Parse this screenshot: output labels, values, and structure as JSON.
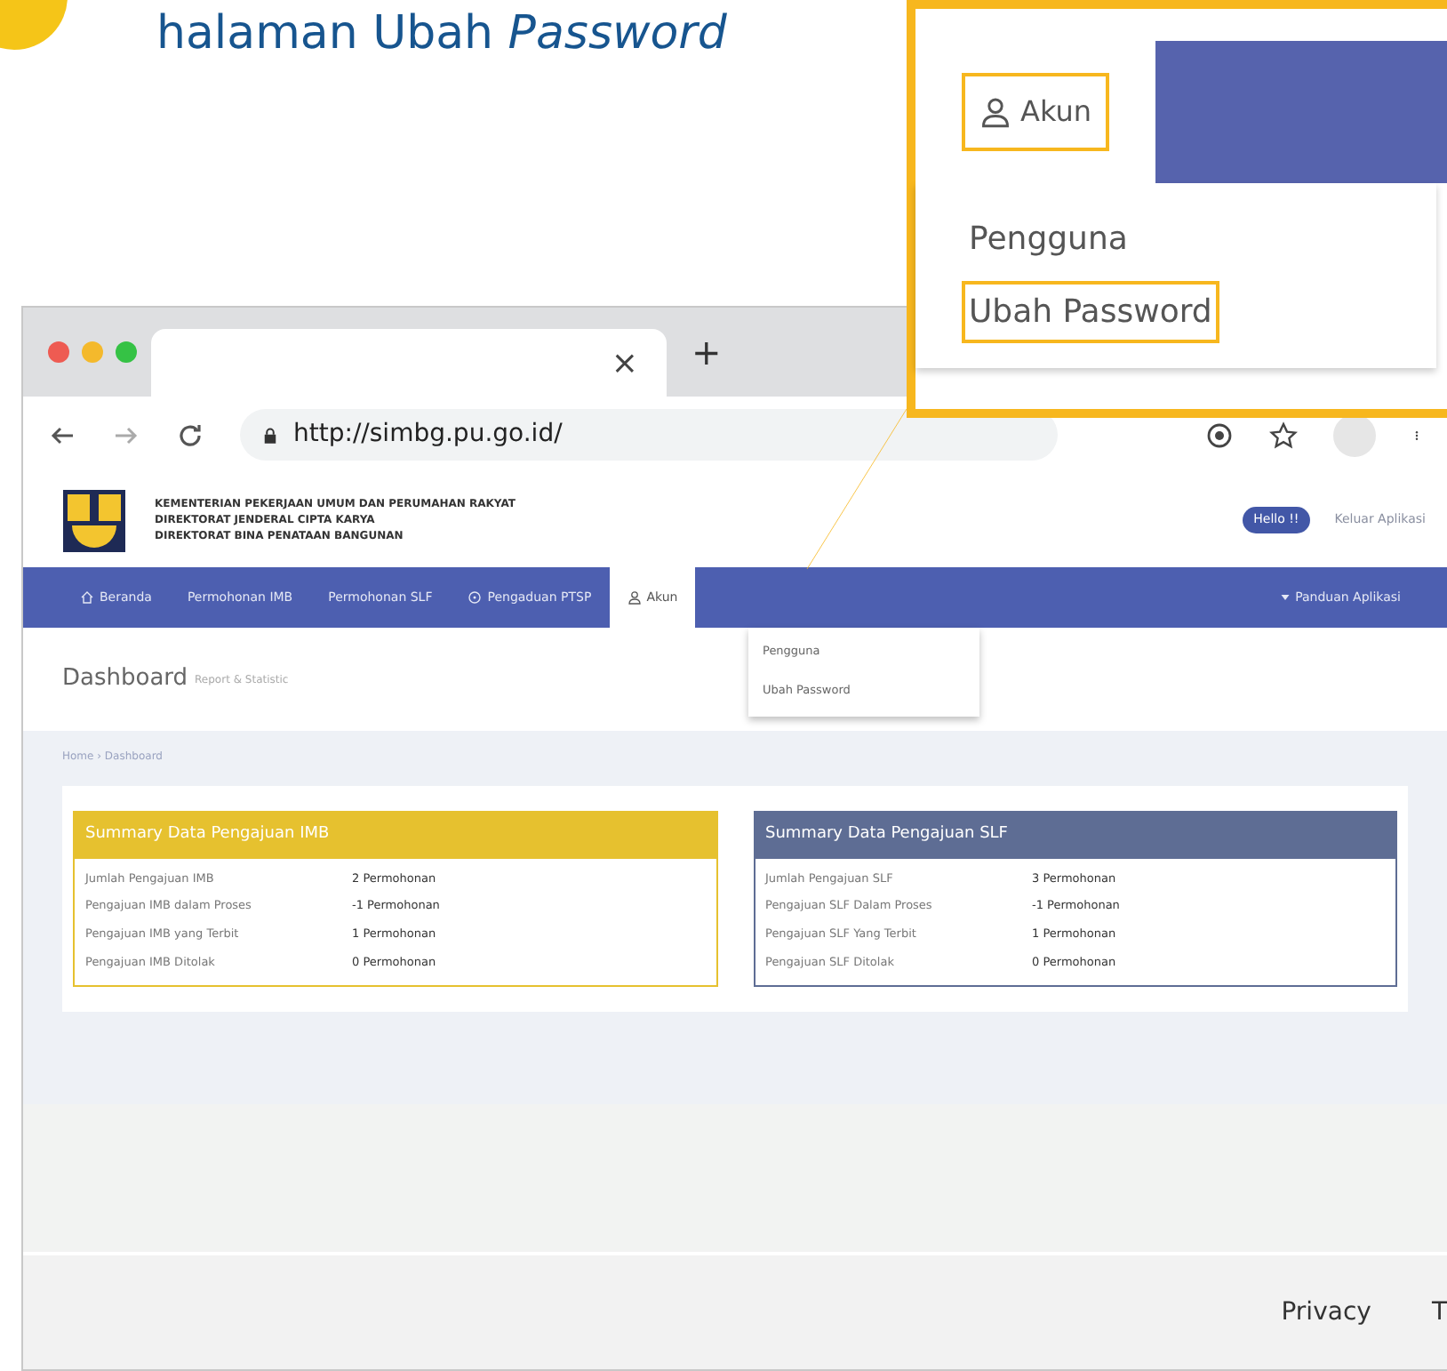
{
  "heading": {
    "text": "halaman Ubah *Password*"
  },
  "browser": {
    "tab_close": "×",
    "new_tab": "+",
    "url": "http://simbg.pu.go.id/"
  },
  "site": {
    "org_lines": [
      "KEMENTERIAN PEKERJAAN UMUM DAN PERUMAHAN RAKYAT",
      "DIREKTORAT JENDERAL CIPTA KARYA",
      "DIREKTORAT BINA PENATAAN BANGUNAN"
    ],
    "user_badge": "Hello !!",
    "header_link": "Keluar Aplikasi",
    "nav": [
      {
        "kind": "home",
        "label": "Beranda",
        "selected": false
      },
      {
        "kind": "plain",
        "label": "Permohonan IMB",
        "selected": false
      },
      {
        "kind": "plain",
        "label": "Permohonan SLF",
        "selected": false
      },
      {
        "kind": "help",
        "label": "Pengaduan PTSP",
        "selected": false
      },
      {
        "kind": "account",
        "label": "Akun",
        "selected": true
      }
    ],
    "nav_right": {
      "label": "Panduan Aplikasi"
    },
    "dropdown": [
      "Pengguna",
      "Ubah Password"
    ],
    "page_title": "Dashboard",
    "page_subtitle": "Report & Statistic",
    "breadcrumb": "Home › Dashboard",
    "cards": [
      {
        "title": "Summary Data Pengajuan IMB",
        "color": "#e6c12f",
        "rows": [
          [
            "Jumlah Pengajuan IMB",
            "2 Permohonan"
          ],
          [
            "Pengajuan IMB dalam Proses",
            "-1 Permohonan"
          ],
          [
            "Pengajuan IMB yang Terbit",
            "1 Permohonan"
          ],
          [
            "Pengajuan IMB Ditolak",
            "0 Permohonan"
          ]
        ]
      },
      {
        "title": "Summary Data Pengajuan SLF",
        "color": "#5e6d94",
        "rows": [
          [
            "Jumlah Pengajuan SLF",
            "3 Permohonan"
          ],
          [
            "Pengajuan SLF Dalam Proses",
            "-1 Permohonan"
          ],
          [
            "Pengajuan SLF Yang Terbit",
            "1 Permohonan"
          ],
          [
            "Pengajuan SLF Ditolak",
            "0 Permohonan"
          ]
        ]
      }
    ],
    "footer": [
      "Privacy",
      "T"
    ]
  },
  "callout": {
    "menu": "Akun",
    "items": [
      {
        "label": "Pengguna",
        "highlighted": false
      },
      {
        "label": "Ubah Password",
        "highlighted": true
      }
    ]
  }
}
